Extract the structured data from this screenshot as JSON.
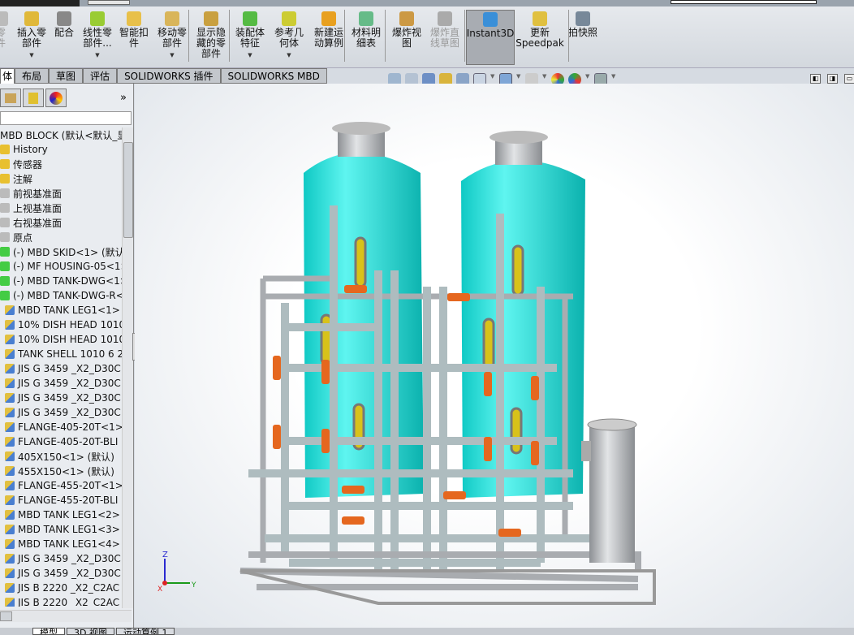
{
  "toolbar": [
    {
      "label": "零\n件",
      "disabled": true,
      "dropdown": false
    },
    {
      "label": "插入零\n部件",
      "dropdown": true
    },
    {
      "label": "配合",
      "dropdown": false
    },
    {
      "label": "线性零\n部件...",
      "dropdown": true
    },
    {
      "label": "智能扣\n件",
      "dropdown": false
    },
    {
      "label": "移动零\n部件",
      "dropdown": true
    },
    {
      "label": "显示隐\n藏的零\n部件",
      "dropdown": false
    },
    {
      "label": "装配体\n特征",
      "dropdown": true
    },
    {
      "label": "参考几\n何体",
      "dropdown": true
    },
    {
      "label": "新建运\n动算例",
      "dropdown": false
    },
    {
      "label": "材料明\n细表",
      "dropdown": false
    },
    {
      "label": "爆炸视\n图",
      "dropdown": false
    },
    {
      "label": "爆炸直\n线草图",
      "disabled": true,
      "dropdown": false
    },
    {
      "label": "Instant3D",
      "active": true,
      "dropdown": false
    },
    {
      "label": "更新\nSpeedpak",
      "dropdown": false
    },
    {
      "label": "拍快照",
      "dropdown": false
    }
  ],
  "tabs": [
    "体",
    "布局",
    "草图",
    "评估",
    "SOLIDWORKS 插件",
    "SOLIDWORKS MBD"
  ],
  "active_tab": "体",
  "tree": [
    "MBD BLOCK  (默认<默认_显",
    "History",
    "传感器",
    "注解",
    "前视基准面",
    "上视基准面",
    "右视基准面",
    "原点",
    "(-) MBD SKID<1> (默认)",
    "(-) MF HOUSING-05<1>",
    "(-) MBD TANK-DWG<1>",
    "(-) MBD TANK-DWG-R<",
    "MBD TANK LEG1<1>",
    "10% DISH HEAD 1010",
    "10% DISH HEAD 1010",
    "TANK SHELL 1010 6 2",
    "JIS G 3459 _X2_D30C",
    "JIS G 3459 _X2_D30C",
    "JIS G 3459 _X2_D30C",
    "JIS G 3459 _X2_D30C",
    "FLANGE-405-20T<1>",
    "FLANGE-405-20T-BLI",
    "405X150<1> (默认)",
    "455X150<1> (默认)",
    "FLANGE-455-20T<1>",
    "FLANGE-455-20T-BLI",
    "MBD TANK LEG1<2>",
    "MBD TANK LEG1<3>",
    "MBD TANK LEG1<4>",
    "JIS G 3459 _X2_D30C",
    "JIS G 3459 _X2_D30C",
    "JIS B 2220 _X2_C2AC",
    "JIS B 2220 _X2_C2AC"
  ],
  "bottom_tabs": [
    "模型",
    "3D 视图",
    "运动算例 1"
  ],
  "panel": {
    "expand": "»"
  },
  "triad": {
    "x": "X",
    "y": "Y",
    "z": "Z"
  },
  "colors": {
    "tank": "#19e6e0",
    "frame": "#a9acb0",
    "valve": "#e5671f",
    "window": "#d8c21a"
  }
}
